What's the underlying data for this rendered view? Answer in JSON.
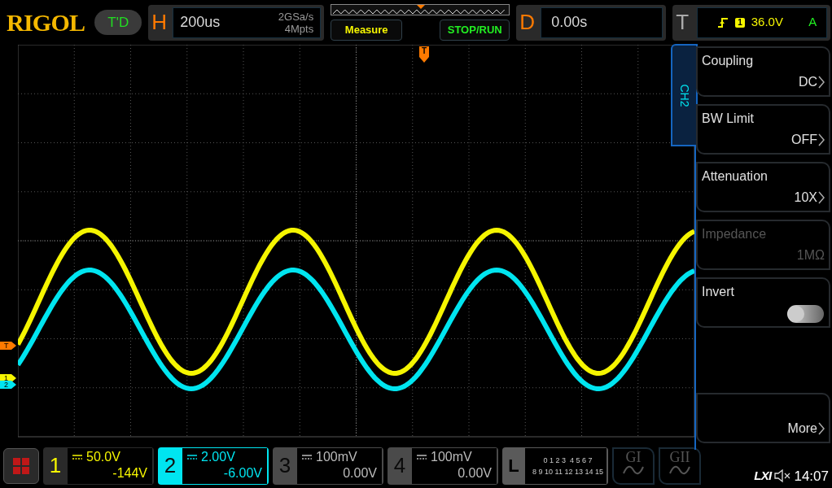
{
  "brand": {
    "logo": "RIGOL",
    "mode_badge": "T'D"
  },
  "horizontal": {
    "label": "H",
    "timebase": "200us",
    "sample_rate": "2GSa/s",
    "memory_depth": "4Mpts"
  },
  "buttons": [
    {
      "label": "Measure",
      "kind": "measure"
    },
    {
      "label": "STOP/RUN",
      "kind": "run"
    }
  ],
  "delay": {
    "label": "D",
    "value": "0.00s"
  },
  "trigger": {
    "label": "T",
    "source": "1",
    "level": "36.0V",
    "mode": "A"
  },
  "trigger_marker": {
    "label": "T"
  },
  "markers": [
    {
      "label": "T",
      "kind": "trigger"
    },
    {
      "label": "1",
      "kind": "channel"
    },
    {
      "label": "2",
      "kind": "channel"
    }
  ],
  "side_tab": {
    "label": "CH2"
  },
  "menu": [
    {
      "label": "Coupling",
      "value": "DC",
      "kind": "value",
      "disabled": false
    },
    {
      "label": "BW Limit",
      "value": "OFF",
      "kind": "value",
      "disabled": false
    },
    {
      "label": "Attenuation",
      "value": "10X",
      "kind": "value",
      "disabled": false
    },
    {
      "label": "Impedance",
      "value": "1MΩ",
      "kind": "value",
      "disabled": true
    },
    {
      "label": "Invert",
      "kind": "toggle",
      "on": false,
      "disabled": false
    },
    {
      "label": "More",
      "kind": "more",
      "disabled": false
    }
  ],
  "channels": [
    {
      "number": "1",
      "scale": "50.0V",
      "offset": "-144V",
      "on": true,
      "selected": false,
      "color": "#f5f500"
    },
    {
      "number": "2",
      "scale": "2.00V",
      "offset": "-6.00V",
      "on": true,
      "selected": true,
      "color": "#00e5f0"
    },
    {
      "number": "3",
      "scale": "100mV",
      "offset": "0.00V",
      "on": false,
      "selected": false
    },
    {
      "number": "4",
      "scale": "100mV",
      "offset": "0.00V",
      "on": false,
      "selected": false
    }
  ],
  "logic": {
    "label": "L",
    "row_1": "0 1 2 3  4 5 6 7",
    "row_2": "8 9 10 11 12 13 14 15"
  },
  "generators": [
    {
      "label": "GI"
    },
    {
      "label": "GII"
    }
  ],
  "status": {
    "lxi": "LXI",
    "time": "14:07"
  }
}
